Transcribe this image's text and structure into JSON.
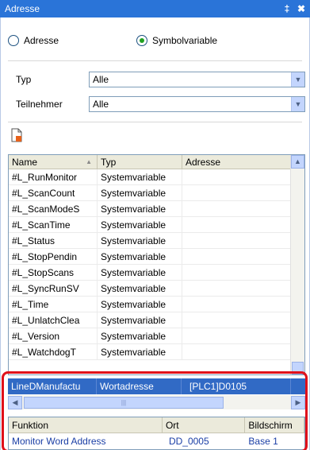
{
  "window": {
    "title": "Adresse",
    "pin_glyph": "‡",
    "close_glyph": "✖"
  },
  "mode": {
    "option_address": "Adresse",
    "option_symbol": "Symbolvariable",
    "selected": "Symbolvariable"
  },
  "filters": {
    "type_label": "Typ",
    "type_value": "Alle",
    "participant_label": "Teilnehmer",
    "participant_value": "Alle"
  },
  "toolbar": {
    "new_icon": "new-document-icon"
  },
  "grid": {
    "columns": [
      "Name",
      "Typ",
      "Adresse"
    ],
    "rows": [
      {
        "name": "#L_RunMonitor",
        "type": "Systemvariable",
        "address": ""
      },
      {
        "name": "#L_ScanCount",
        "type": "Systemvariable",
        "address": ""
      },
      {
        "name": "#L_ScanModeS",
        "type": "Systemvariable",
        "address": ""
      },
      {
        "name": "#L_ScanTime",
        "type": "Systemvariable",
        "address": ""
      },
      {
        "name": "#L_Status",
        "type": "Systemvariable",
        "address": ""
      },
      {
        "name": "#L_StopPendin",
        "type": "Systemvariable",
        "address": ""
      },
      {
        "name": "#L_StopScans",
        "type": "Systemvariable",
        "address": ""
      },
      {
        "name": "#L_SyncRunSV",
        "type": "Systemvariable",
        "address": ""
      },
      {
        "name": "#L_Time",
        "type": "Systemvariable",
        "address": ""
      },
      {
        "name": "#L_UnlatchClea",
        "type": "Systemvariable",
        "address": ""
      },
      {
        "name": "#L_Version",
        "type": "Systemvariable",
        "address": ""
      },
      {
        "name": "#L_WatchdogT",
        "type": "Systemvariable",
        "address": ""
      }
    ],
    "selected_row": {
      "name": "LineDManufactu",
      "type": "Wortadresse",
      "address": "[PLC1]D0105"
    }
  },
  "usage": {
    "columns": [
      "Funktion",
      "Ort",
      "Bildschirm"
    ],
    "rows": [
      {
        "function": "Monitor Word Address",
        "location": "DD_0005",
        "screen": "Base 1"
      }
    ]
  },
  "colors": {
    "titlebar": "#2a74d8",
    "selection": "#316ac5",
    "highlight_border": "#e0101a",
    "link_text": "#1a3ea5"
  }
}
